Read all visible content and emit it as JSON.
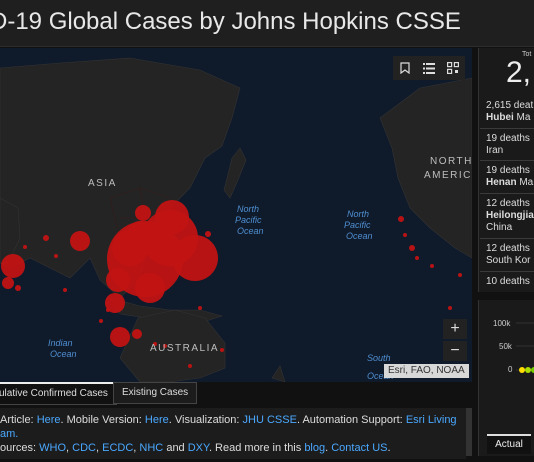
{
  "header": {
    "title": "D-19 Global Cases by Johns Hopkins CSSE"
  },
  "map": {
    "labels": {
      "asia": "ASIA",
      "australia": "AUSTRALIA",
      "north_america_1": "NORTH",
      "north_america_2": "AMERICA",
      "north_pacific_a_1": "North",
      "north_pacific_a_2": "Pacific",
      "north_pacific_a_3": "Ocean",
      "north_pacific_b_1": "North",
      "north_pacific_b_2": "Pacific",
      "north_pacific_b_3": "Ocean",
      "indian_1": "Indian",
      "indian_2": "Ocean",
      "south_1": "South",
      "south_2": "Ocean"
    },
    "attribution": "Esri, FAO, NOAA",
    "zoom_in": "+",
    "zoom_out": "−",
    "tools": {
      "bookmark_icon": "bookmark-icon",
      "list_icon": "list-icon",
      "qr_icon": "qr-icon"
    },
    "bubble_color": "#cc1111"
  },
  "tabs": {
    "confirmed": "ulative Confirmed Cases",
    "existing": "Existing Cases"
  },
  "footer": {
    "l1_prefix": "Article: ",
    "l1_here1": "Here",
    "l1_mid": ". Mobile Version: ",
    "l1_here2": "Here",
    "l1_viz": ". Visualization: ",
    "l1_jhu": "JHU CSSE",
    "l1_auto": ". Automation Support: ",
    "l1_esri": "Esri Living",
    "l2_team": "am.",
    "l3_prefix": "ources: ",
    "l3_who": "WHO",
    "l3_cdc": "CDC",
    "l3_ecdc": "ECDC",
    "l3_nhc": "NHC",
    "l3_and": " and ",
    "l3_dxy": "DXY",
    "l3_read": ". Read more in this ",
    "l3_blog": "blog",
    "l3_contact": "Contact US",
    "comma": ", ",
    "dot": ". ",
    "end": "."
  },
  "right_panel": {
    "total_label": "Tot",
    "total_value": "2,",
    "items": [
      {
        "l1": "2,615 deat",
        "l2b": "Hubei",
        "l2": " Ma"
      },
      {
        "l1": "19 deaths",
        "l2": "Iran"
      },
      {
        "l1": "19 deaths",
        "l2b": "Henan",
        "l2": " Ma"
      },
      {
        "l1": "12 deaths",
        "l2b": "Heilongjia",
        "l2": "",
        "l3": "China"
      },
      {
        "l1": "12 deaths",
        "l2": "South Kor"
      },
      {
        "l1": "10 deaths",
        "l2": ""
      }
    ]
  },
  "mini_chart": {
    "yticks": [
      "100k",
      "50k",
      "0"
    ],
    "tab": "Actual"
  }
}
